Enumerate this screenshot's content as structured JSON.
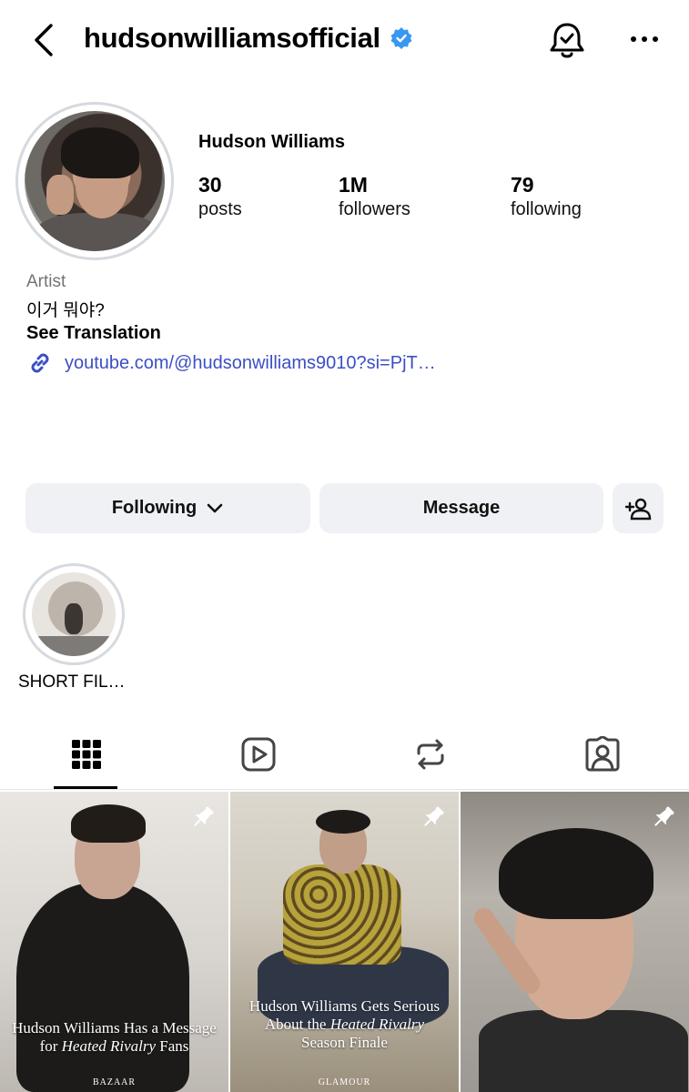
{
  "header": {
    "username": "hudsonwilliamsofficial",
    "verified_color": "#3897f0"
  },
  "profile": {
    "display_name": "Hudson Williams",
    "stats": {
      "posts_count": "30",
      "posts_label": "posts",
      "followers_count": "1M",
      "followers_label": "followers",
      "following_count": "79",
      "following_label": "following"
    },
    "category": "Artist",
    "bio": "이거 뭐야?",
    "see_translation": "See Translation",
    "link": "youtube.com/@hudsonwilliams9010?si=PjT…",
    "link_color": "#3b4fc4"
  },
  "actions": {
    "following_label": "Following",
    "message_label": "Message"
  },
  "highlights": [
    {
      "label": "SHORT FIL…"
    }
  ],
  "tabs": [
    {
      "icon": "grid-icon",
      "active": true
    },
    {
      "icon": "reels-icon",
      "active": false
    },
    {
      "icon": "reposts-icon",
      "active": false
    },
    {
      "icon": "tagged-icon",
      "active": false
    }
  ],
  "posts": [
    {
      "pinned": true,
      "caption_line1": "Hudson Williams Has a Message",
      "caption_line2_pre": "for ",
      "caption_line2_em": "Heated Rivalry",
      "caption_line2_post": " Fans",
      "brand": "BAZAAR"
    },
    {
      "pinned": true,
      "caption_line1": "Hudson Williams Gets Serious",
      "caption_line2_pre": "About the ",
      "caption_line2_em": "Heated Rivalry",
      "caption_line3": "Season Finale",
      "brand": "GLAMOUR"
    },
    {
      "pinned": true
    }
  ]
}
